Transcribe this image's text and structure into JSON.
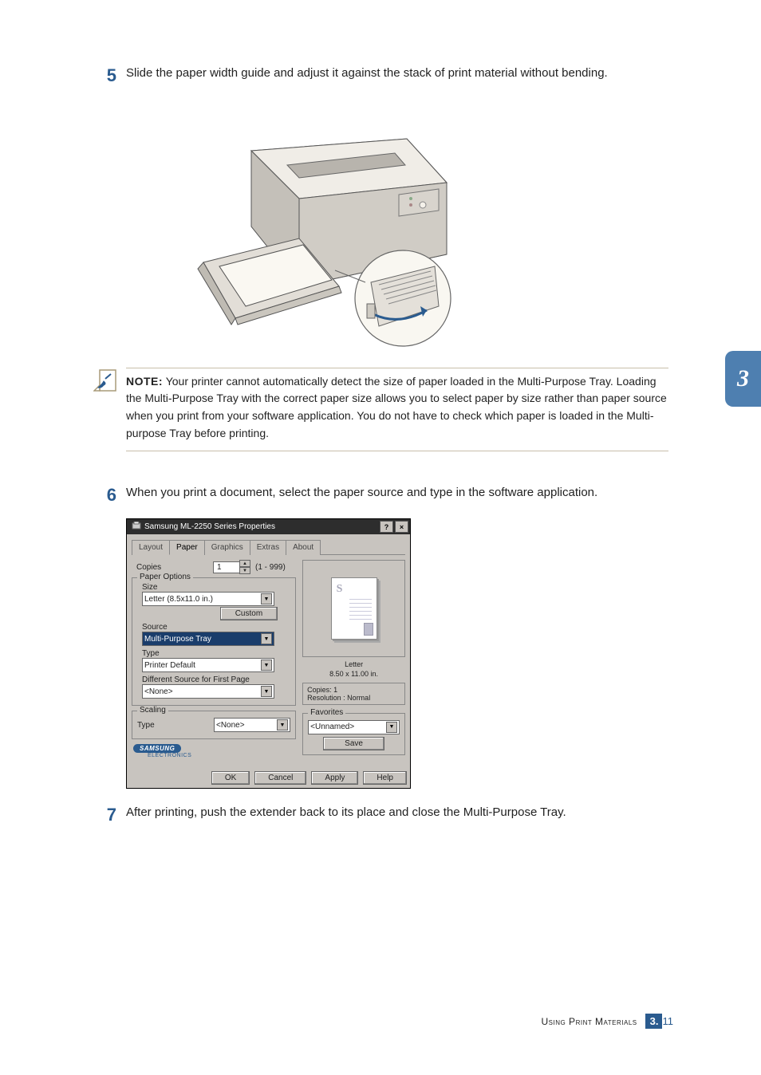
{
  "sideTab": "3",
  "steps": {
    "s5": {
      "num": "5",
      "text": "Slide the paper width guide and adjust it against the stack of print material without bending."
    },
    "s6": {
      "num": "6",
      "text": "When you print a document, select the paper source and type in the software application."
    },
    "s7": {
      "num": "7",
      "text": "After printing, push the extender back to its place and close the Multi-Purpose Tray."
    }
  },
  "note": {
    "title": "NOTE:",
    "body": " Your printer cannot automatically detect the size of paper loaded in the Multi-Purpose Tray. Loading the Multi-Purpose Tray with the correct paper size allows you to select paper by size rather than paper source when you print from your software application. You do not have to check which paper is loaded in the Multi-purpose Tray before printing."
  },
  "dialog": {
    "title": "Samsung ML-2250 Series Properties",
    "helpGlyph": "?",
    "closeGlyph": "×",
    "tabs": [
      "Layout",
      "Paper",
      "Graphics",
      "Extras",
      "About"
    ],
    "activeTab": 1,
    "copiesLabel": "Copies",
    "copiesValue": "1",
    "copiesRange": "(1 - 999)",
    "paperOptions": {
      "legend": "Paper Options",
      "sizeLabel": "Size",
      "sizeValue": "Letter (8.5x11.0 in.)",
      "customBtn": "Custom",
      "sourceLabel": "Source",
      "sourceValue": "Multi-Purpose Tray",
      "typeLabel": "Type",
      "typeValue": "Printer Default",
      "diffSourceLabel": "Different Source for First Page",
      "diffSourceValue": "<None>"
    },
    "scaling": {
      "legend": "Scaling",
      "typeLabel": "Type",
      "typeValue": "<None>"
    },
    "preview": {
      "mark": "S",
      "sizeName": "Letter",
      "sizeDims": "8.50 x 11.00 in."
    },
    "info": {
      "copies": "Copies: 1",
      "resolution": "Resolution : Normal"
    },
    "favorites": {
      "legend": "Favorites",
      "value": "<Unnamed>",
      "saveBtn": "Save"
    },
    "brand": {
      "name": "SAMSUNG",
      "sub": "ELECTRONICS"
    },
    "buttons": {
      "ok": "OK",
      "cancel": "Cancel",
      "apply": "Apply",
      "help": "Help"
    }
  },
  "footer": {
    "text": "Using Print Materials",
    "chapter": "3.",
    "page": "11"
  }
}
